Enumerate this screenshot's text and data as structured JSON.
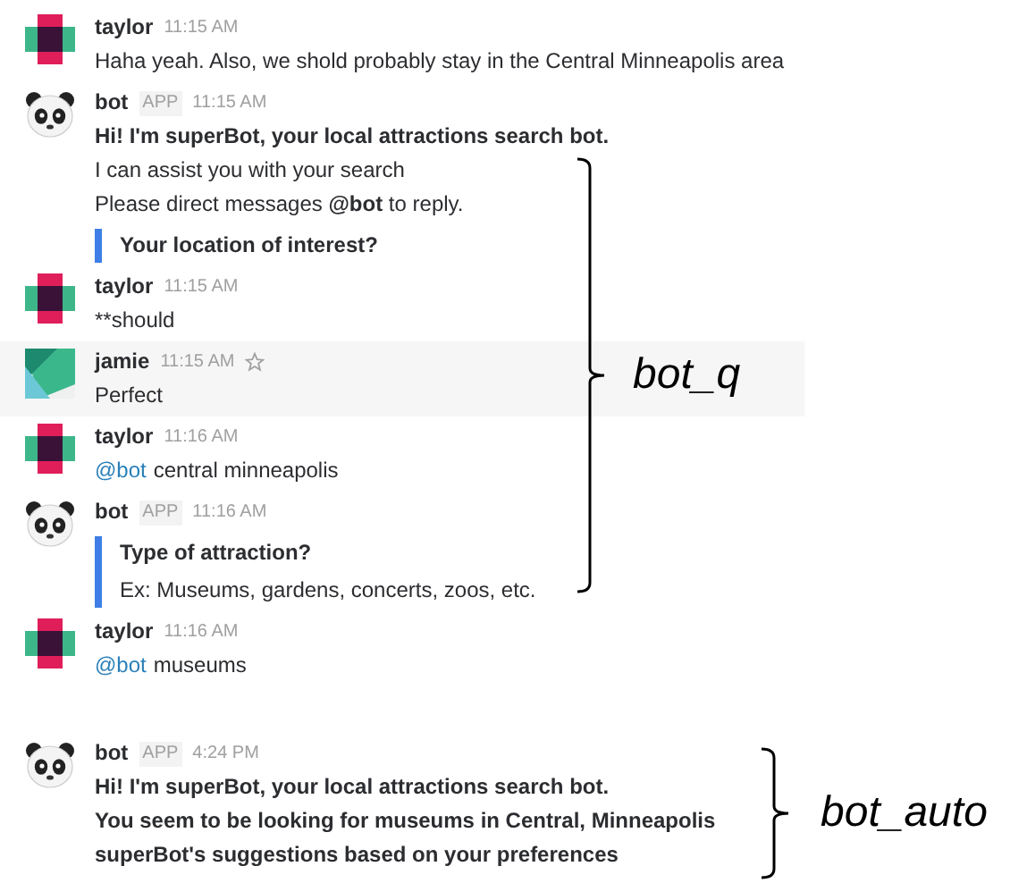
{
  "groups": [
    {
      "messages": [
        {
          "kind": "taylor",
          "name": "taylor",
          "time": "11:15 AM",
          "lines": [
            {
              "kind": "text",
              "text": "Haha yeah. Also, we shold probably stay in the Central Minneapolis area"
            }
          ]
        },
        {
          "kind": "panda",
          "name": "bot",
          "badge": "APP",
          "time": "11:15 AM",
          "lines": [
            {
              "kind": "bold",
              "text": "Hi! I'm superBot, your local attractions search bot."
            },
            {
              "kind": "text",
              "text": "I can assist you with your search"
            },
            {
              "kind": "text",
              "text": "Please direct messages **@bot** to reply."
            },
            {
              "kind": "quote",
              "title": "Your location of interest?"
            }
          ]
        },
        {
          "kind": "taylor",
          "name": "taylor",
          "time": "11:15 AM",
          "lines": [
            {
              "kind": "text",
              "text": "**should"
            }
          ]
        },
        {
          "kind": "jamie",
          "name": "jamie",
          "time": "11:15 AM",
          "highlighted": true,
          "lines": [
            {
              "kind": "text",
              "text": "Perfect"
            }
          ]
        },
        {
          "kind": "taylor",
          "name": "taylor",
          "time": "11:16 AM",
          "lines": [
            {
              "kind": "mention",
              "mention": "@bot",
              "text": "central minneapolis"
            }
          ]
        },
        {
          "kind": "panda",
          "name": "bot",
          "badge": "APP",
          "time": "11:16 AM",
          "lines": [
            {
              "kind": "quote",
              "title": "Type of attraction?",
              "text": "Ex: Museums, gardens, concerts, zoos, etc."
            }
          ]
        },
        {
          "kind": "taylor",
          "name": "taylor",
          "time": "11:16 AM",
          "lines": [
            {
              "kind": "mention",
              "mention": "@bot",
              "text": "museums"
            }
          ]
        }
      ],
      "annotation": "bot_q"
    },
    {
      "messages": [
        {
          "kind": "panda",
          "name": "bot",
          "badge": "APP",
          "time": "4:24 PM",
          "lines": [
            {
              "kind": "bold",
              "text": "Hi! I'm superBot, your local attractions search bot."
            },
            {
              "kind": "bold",
              "text": "You seem to be looking for museums in Central, Minneapolis"
            },
            {
              "kind": "bold",
              "text": "superBot's suggestions based on your preferences"
            }
          ]
        }
      ],
      "annotation": "bot_auto"
    }
  ]
}
